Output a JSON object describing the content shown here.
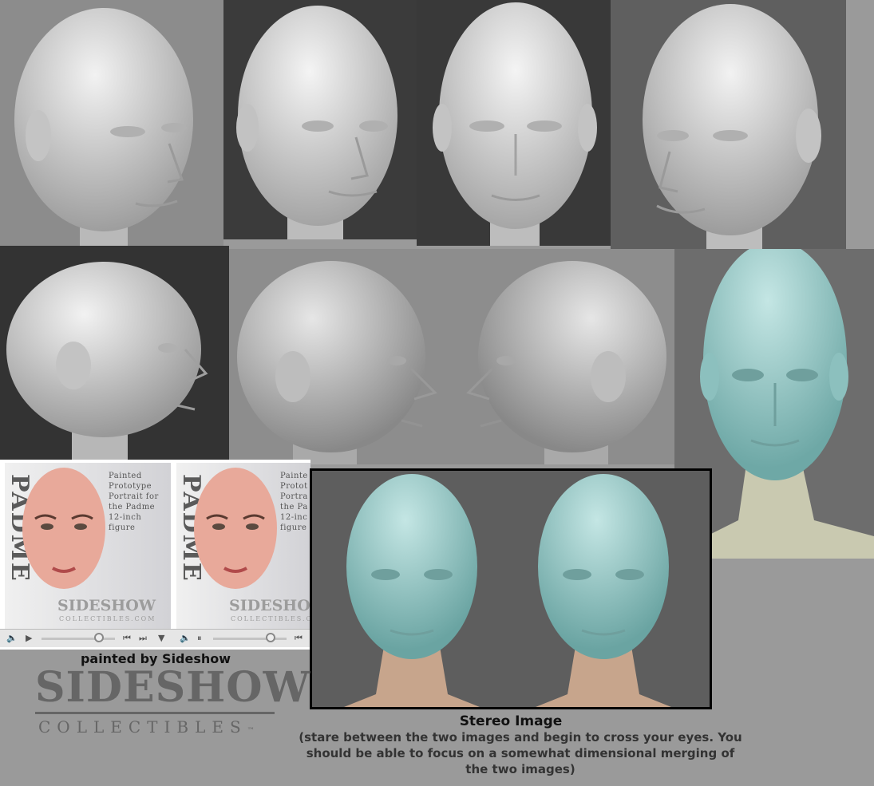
{
  "photos": {
    "top_row_icons": [
      "head-three-quarter-left-icon",
      "head-three-quarter-front-icon",
      "head-front-icon",
      "head-three-quarter-right-icon"
    ],
    "middle_row_icons": [
      "head-profile-right-icon",
      "head-profile-right-icon",
      "head-profile-left-icon",
      "head-teal-front-icon"
    ]
  },
  "video_panels": [
    {
      "label": "Painted\nPrototype\nPortrait for\nthe Padme\n12-inch\nfigure",
      "side_text": "PADME",
      "brand": "SIDESHOW",
      "brand_sub": "COLLECTIBLES.COM",
      "play_icon": "play-icon",
      "volume_icon": "volume-icon"
    },
    {
      "label": "Painte\nProtot\nPortra\nthe Pa\n12-inc\nfigure",
      "side_text": "PADME",
      "brand": "SIDESHOW",
      "brand_sub": "COLLECTIBLES.COM",
      "play_icon": "pause-icon",
      "volume_icon": "volume-icon"
    }
  ],
  "captions": {
    "painted_by": "painted by Sideshow",
    "stereo_title": "Stereo Image",
    "stereo_note": "(stare between the two images and begin to cross your eyes. You should be able to focus on a somewhat dimensional merging of the two images)"
  },
  "logo": {
    "main": "SIDESHOW",
    "sub": "COLLECTIBLES",
    "tm": "™"
  },
  "colors": {
    "background": "#9a9a9a",
    "gray_sculpt": "#d6d6d6",
    "teal_sculpt": "#8ec4c2",
    "painted_skin": "#e8a99a"
  }
}
